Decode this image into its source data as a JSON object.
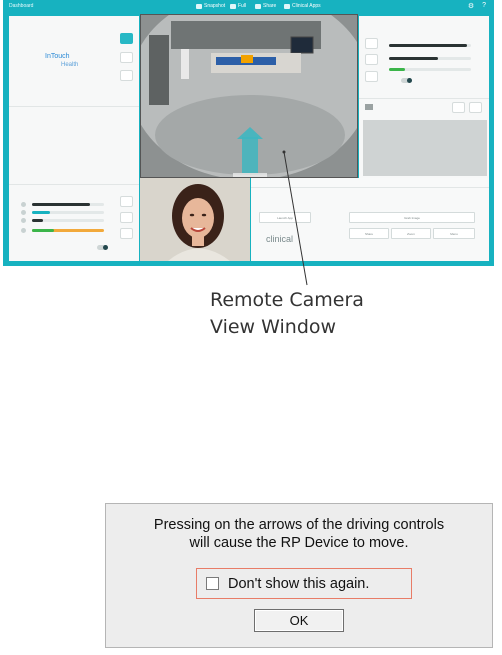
{
  "app": {
    "title": "Dashboard",
    "top_menu": [
      {
        "icon": "camera-icon",
        "label": "Snapshot"
      },
      {
        "icon": "film-icon",
        "label": "Full"
      },
      {
        "icon": "share-icon",
        "label": "Share"
      },
      {
        "icon": "clipboard-icon",
        "label": "Clinical Apps"
      }
    ],
    "top_right_icons": [
      "gear-icon",
      "help-icon"
    ],
    "logo": {
      "line1": "InTouch",
      "line2": "Health"
    },
    "bottom_brand": "clinical",
    "controls": {
      "buttons": [
        "Launch App",
        "Grab Image",
        "Share",
        "Zoom",
        "Menu"
      ]
    },
    "levels": {
      "left_sliders": [
        0.8,
        0.25,
        0.15,
        0.3
      ],
      "right_sliders": [
        0.95,
        0.6,
        0.2
      ]
    },
    "colors": {
      "accent": "#17b2c0",
      "green": "#3bb54a",
      "orange": "#f2a93b"
    }
  },
  "callout": {
    "line1": "Remote Camera",
    "line2": "View Window"
  },
  "dialog": {
    "message_line1": "Pressing on the arrows of the driving controls",
    "message_line2": "will cause the RP Device to move.",
    "checkbox_label": "Don't show this again.",
    "checkbox_checked": false,
    "ok_label": "OK"
  }
}
